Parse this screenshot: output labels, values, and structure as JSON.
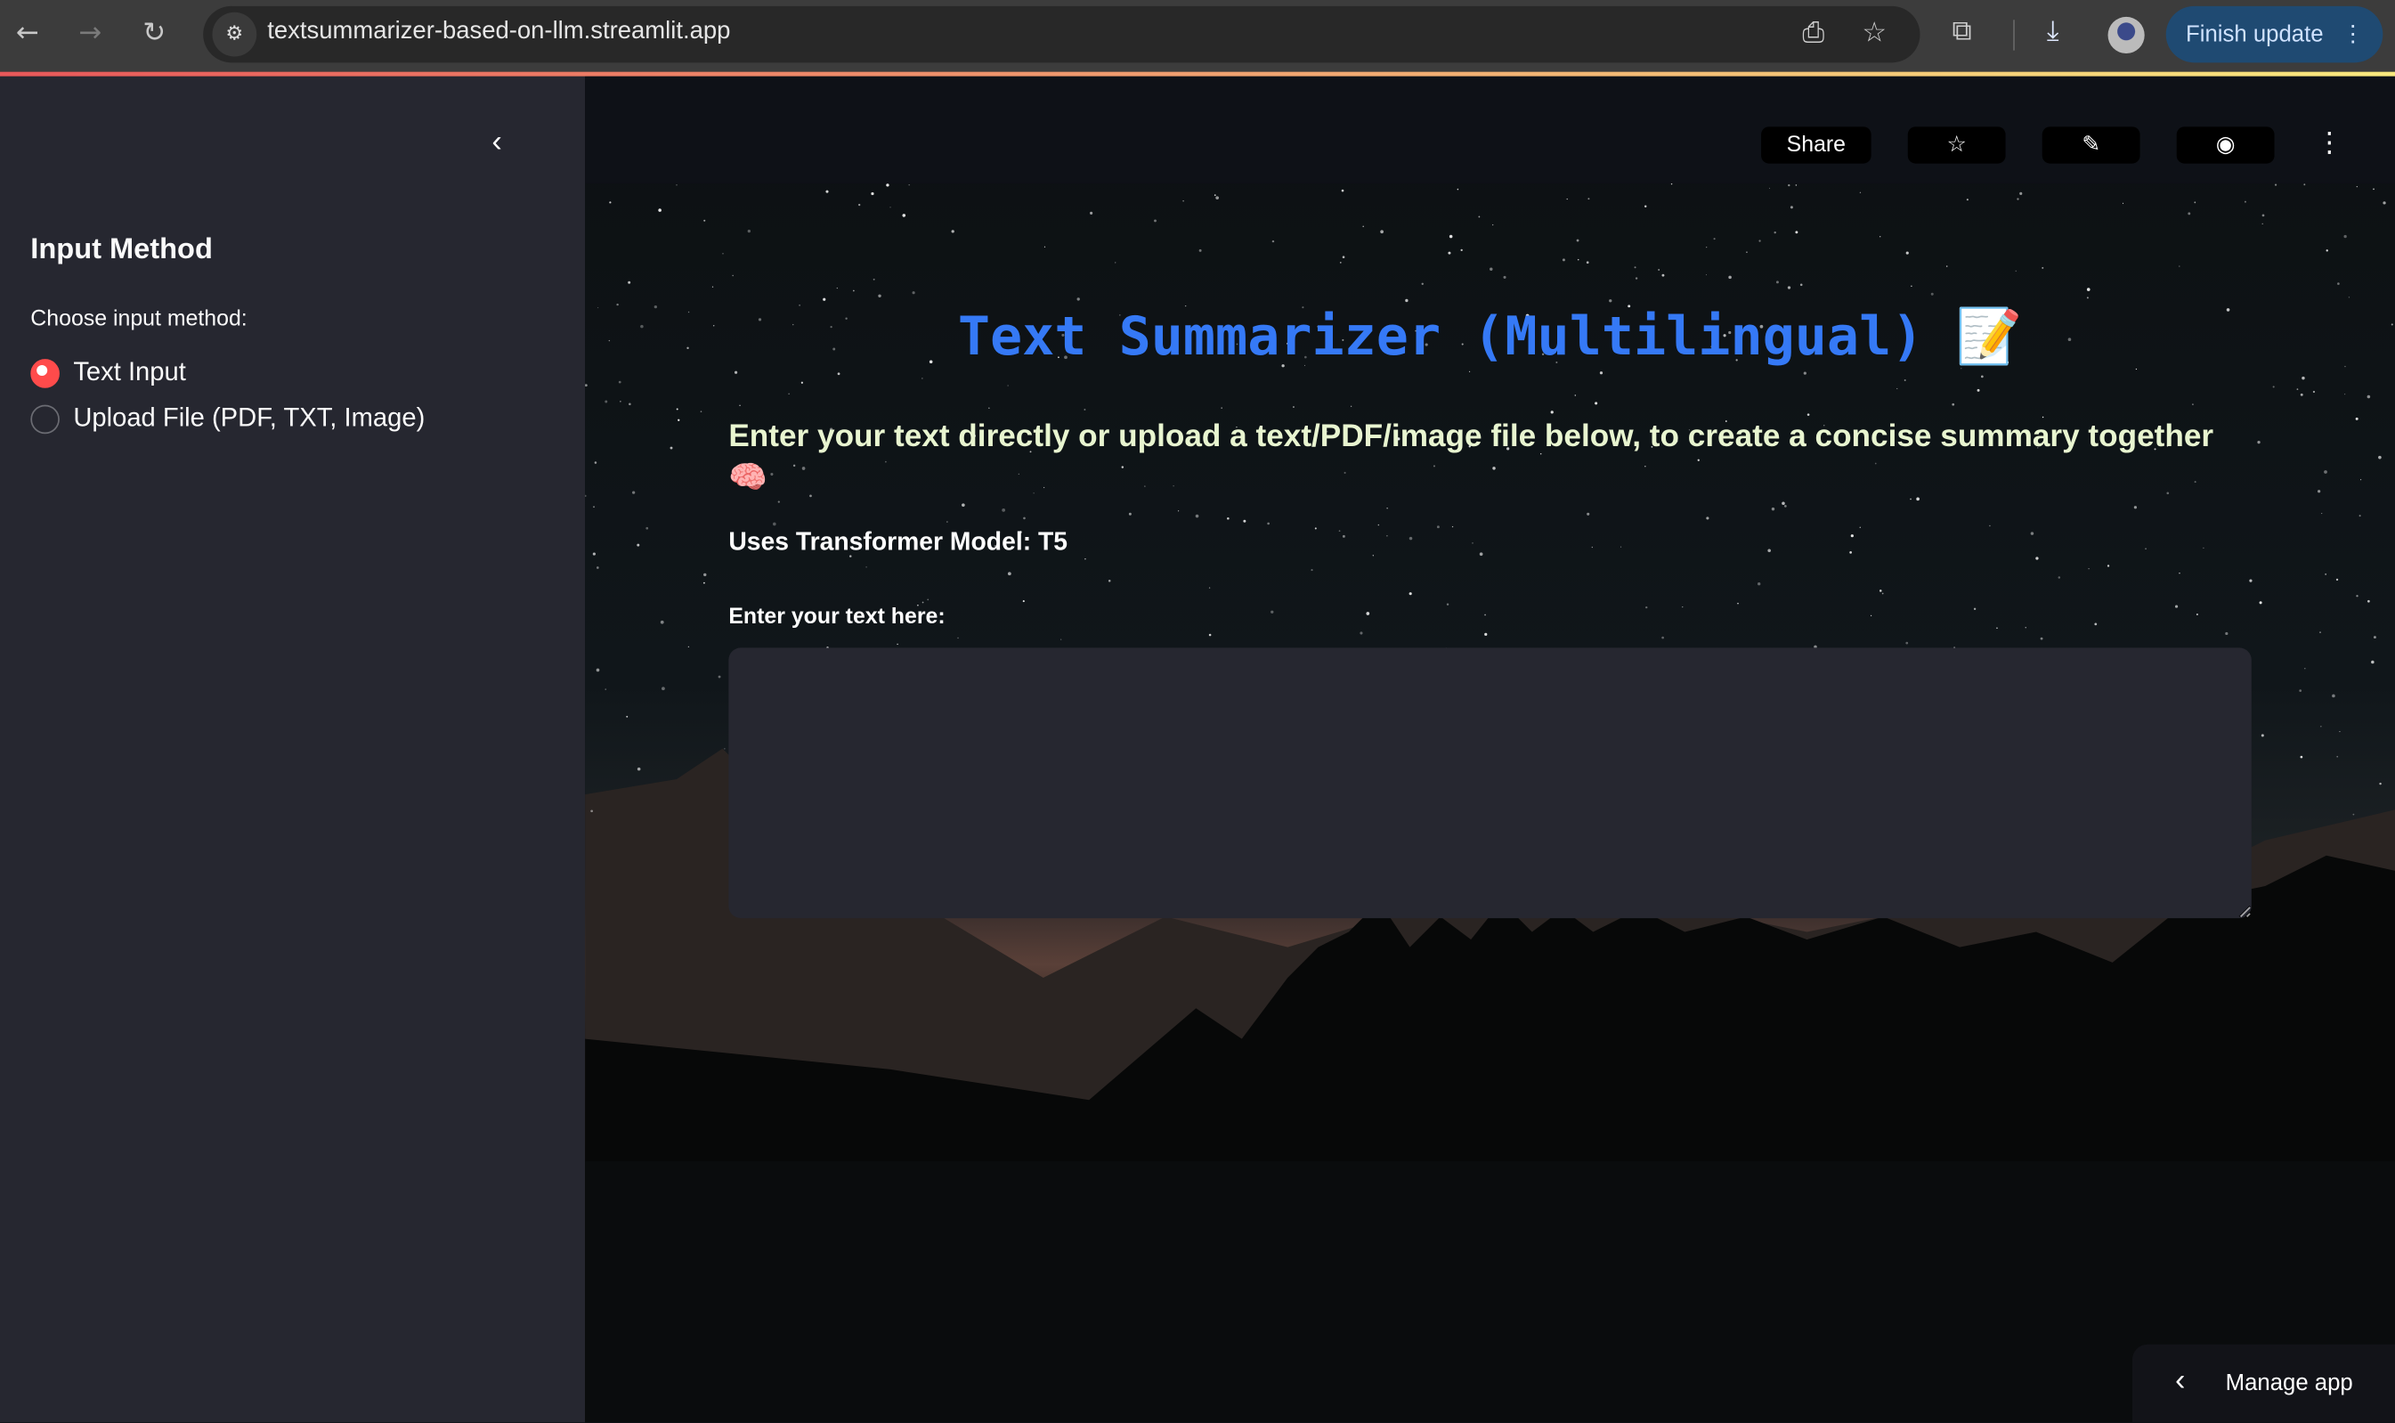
{
  "browser": {
    "url": "textsummarizer-based-on-llm.streamlit.app",
    "finish_update_label": "Finish update",
    "icons": [
      "back-arrow-icon",
      "forward-arrow-icon",
      "reload-icon",
      "site-settings-icon",
      "install-app-icon",
      "bookmark-star-icon",
      "extensions-icon",
      "download-icon",
      "profile-avatar",
      "kebab-menu-icon"
    ]
  },
  "header": {
    "share_label": "Share",
    "icons": [
      "star-icon",
      "pencil-icon",
      "github-icon",
      "kebab-menu-icon"
    ]
  },
  "sidebar": {
    "title": "Input Method",
    "radio_label": "Choose input method:",
    "options": [
      {
        "label": "Text Input",
        "selected": true
      },
      {
        "label": "Upload File (PDF, TXT, Image)",
        "selected": false
      }
    ],
    "accent_color": "#ff4b4b"
  },
  "main": {
    "title": "Text Summarizer (Multilingual) 📝",
    "subtitle": "Enter your text directly or upload a text/PDF/image file below, to create a concise summary together 🧠",
    "model_text": "Uses Transformer Model: T5",
    "textarea_label": "Enter your text here:",
    "textarea_value": "",
    "title_color": "#3579f6"
  },
  "manage_app_label": "Manage app"
}
